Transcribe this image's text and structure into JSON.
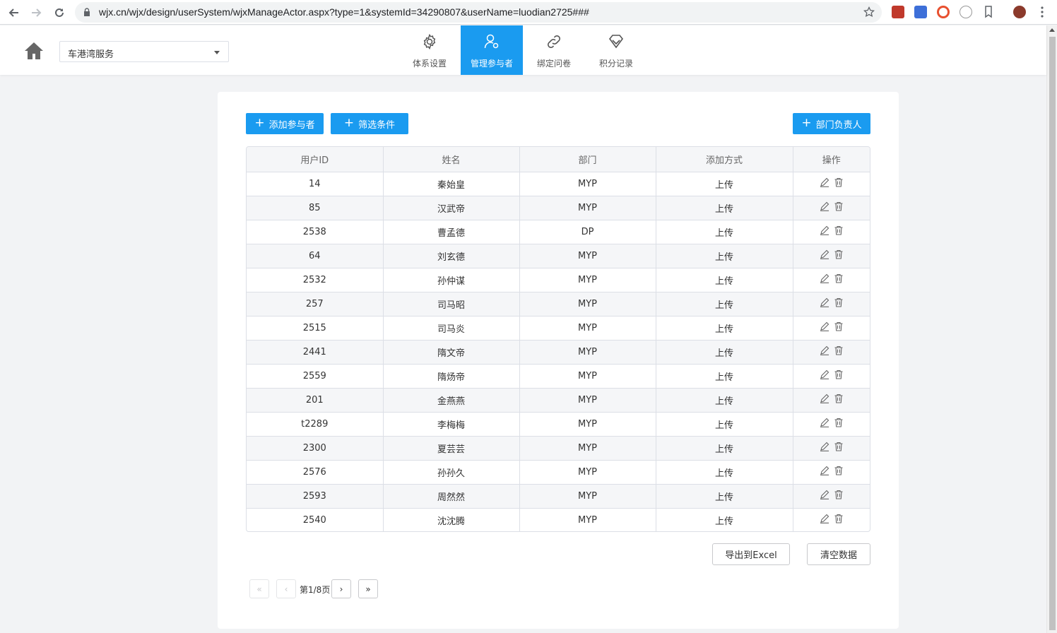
{
  "browser": {
    "url": "wjx.cn/wjx/design/userSystem/wjxManageActor.aspx?type=1&systemId=34290807&userName=luodian2725###"
  },
  "header": {
    "system_select_value": "车港湾服务",
    "tabs": [
      {
        "label": "体系设置",
        "icon": "gear-icon"
      },
      {
        "label": "管理参与者",
        "icon": "user-manage-icon",
        "active": true
      },
      {
        "label": "绑定问卷",
        "icon": "link-icon"
      },
      {
        "label": "积分记录",
        "icon": "diamond-icon"
      }
    ]
  },
  "toolbar": {
    "add_participant": "添加参与者",
    "filter": "筛选条件",
    "dept_head": "部门负责人"
  },
  "table": {
    "columns": [
      "用户ID",
      "姓名",
      "部门",
      "添加方式",
      "操作"
    ],
    "rows": [
      {
        "id": "14",
        "name": "秦始皇",
        "dept": "MYP",
        "method": "上传"
      },
      {
        "id": "85",
        "name": "汉武帝",
        "dept": "MYP",
        "method": "上传"
      },
      {
        "id": "2538",
        "name": "曹孟德",
        "dept": "DP",
        "method": "上传"
      },
      {
        "id": "64",
        "name": "刘玄德",
        "dept": "MYP",
        "method": "上传"
      },
      {
        "id": "2532",
        "name": "孙仲谋",
        "dept": "MYP",
        "method": "上传"
      },
      {
        "id": "257",
        "name": "司马昭",
        "dept": "MYP",
        "method": "上传"
      },
      {
        "id": "2515",
        "name": "司马炎",
        "dept": "MYP",
        "method": "上传"
      },
      {
        "id": "2441",
        "name": "隋文帝",
        "dept": "MYP",
        "method": "上传"
      },
      {
        "id": "2559",
        "name": "隋炀帝",
        "dept": "MYP",
        "method": "上传"
      },
      {
        "id": "201",
        "name": "金燕燕",
        "dept": "MYP",
        "method": "上传"
      },
      {
        "id": "t2289",
        "name": "李梅梅",
        "dept": "MYP",
        "method": "上传"
      },
      {
        "id": "2300",
        "name": "夏芸芸",
        "dept": "MYP",
        "method": "上传"
      },
      {
        "id": "2576",
        "name": "孙孙久",
        "dept": "MYP",
        "method": "上传"
      },
      {
        "id": "2593",
        "name": "周然然",
        "dept": "MYP",
        "method": "上传"
      },
      {
        "id": "2540",
        "name": "沈沈腾",
        "dept": "MYP",
        "method": "上传"
      }
    ]
  },
  "actions": {
    "export": "导出到Excel",
    "clear": "清空数据"
  },
  "pager": {
    "text": "第1/8页",
    "first": "«",
    "prev": "‹",
    "next": "›",
    "last": "»"
  },
  "colors": {
    "accent": "#1a9bf0",
    "page_bg": "#f2f3f5",
    "header_row": "#f5f6f8"
  }
}
